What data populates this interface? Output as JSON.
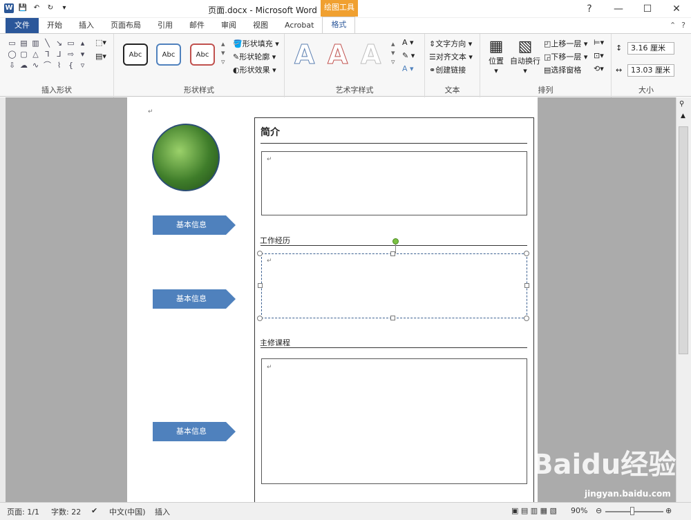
{
  "window": {
    "title": "页面.docx - Microsoft Word",
    "context_tool": "绘图工具"
  },
  "tabs": [
    "文件",
    "开始",
    "插入",
    "页面布局",
    "引用",
    "邮件",
    "审阅",
    "视图",
    "Acrobat",
    "格式"
  ],
  "ribbon": {
    "groups": {
      "insert_shapes": "插入形状",
      "shape_styles": "形状样式",
      "wordart_styles": "艺术字样式",
      "text": "文本",
      "arrange": "排列",
      "size": "大小"
    },
    "style_presets": [
      "Abc",
      "Abc",
      "Abc"
    ],
    "shape_fill": "形状填充",
    "shape_outline": "形状轮廓",
    "shape_effects": "形状效果",
    "text_direction": "文字方向",
    "align_text": "对齐文本",
    "create_link": "创建链接",
    "position": "位置",
    "wrap_text": "自动换行",
    "bring_forward": "上移一层",
    "send_backward": "下移一层",
    "selection_pane": "选择窗格",
    "height": "3.16 厘米",
    "width": "13.03 厘米"
  },
  "document": {
    "intro_title": "简介",
    "work_title": "工作经历",
    "course_title": "主修课程",
    "arrow_labels": [
      "基本信息",
      "基本信息",
      "基本信息"
    ],
    "para_mark": "↵"
  },
  "status": {
    "page": "页面: 1/1",
    "words": "字数: 22",
    "language": "中文(中国)",
    "mode": "插入",
    "zoom": "90%"
  },
  "watermark": {
    "brand": "Baidu经验",
    "url": "jingyan.baidu.com"
  }
}
